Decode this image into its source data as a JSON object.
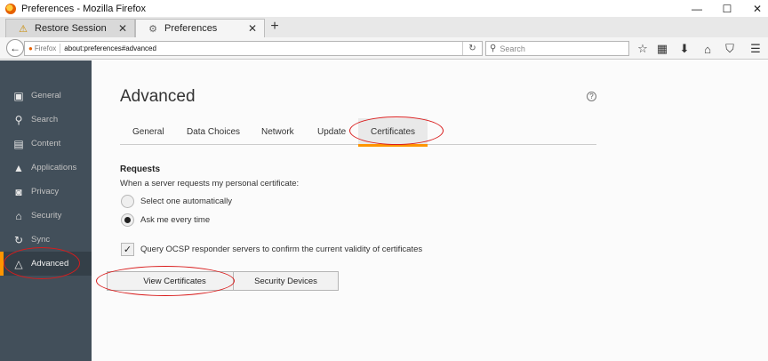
{
  "window": {
    "title": "Preferences - Mozilla Firefox",
    "min": "—",
    "max": "☐",
    "close": "✕"
  },
  "tabs": [
    {
      "label": "Restore Session",
      "icon": "warning-icon",
      "close": "✕"
    },
    {
      "label": "Preferences",
      "icon": "gear-icon",
      "close": "✕"
    }
  ],
  "new_tab": "+",
  "navbar": {
    "back": "←",
    "identity": "Firefox",
    "url": "about:preferences#advanced",
    "reload": "↻",
    "search_placeholder": "Search",
    "icons": [
      "bookmark-star-icon",
      "reading-list-icon",
      "downloads-icon",
      "home-icon",
      "pocket-icon",
      "menu-icon"
    ]
  },
  "sidebar": {
    "items": [
      {
        "label": "General",
        "icon": "general-icon",
        "glyph": "▣"
      },
      {
        "label": "Search",
        "icon": "search-icon",
        "glyph": "⚲"
      },
      {
        "label": "Content",
        "icon": "content-icon",
        "glyph": "▤"
      },
      {
        "label": "Applications",
        "icon": "applications-icon",
        "glyph": "▲"
      },
      {
        "label": "Privacy",
        "icon": "privacy-mask-icon",
        "glyph": "◙"
      },
      {
        "label": "Security",
        "icon": "security-lock-icon",
        "glyph": "⌂"
      },
      {
        "label": "Sync",
        "icon": "sync-icon",
        "glyph": "↻"
      },
      {
        "label": "Advanced",
        "icon": "advanced-wizard-icon",
        "glyph": "△"
      }
    ],
    "active": "Advanced"
  },
  "main": {
    "title": "Advanced",
    "help": "?",
    "subtabs": [
      "General",
      "Data Choices",
      "Network",
      "Update",
      "Certificates"
    ],
    "selected_subtab": "Certificates",
    "requests": {
      "heading": "Requests",
      "label": "When a server requests my personal certificate:",
      "options": [
        "Select one automatically",
        "Ask me every time"
      ],
      "selected": "Ask me every time"
    },
    "ocsp": {
      "label": "Query OCSP responder servers to confirm the current validity of certificates",
      "checked": true
    },
    "buttons": {
      "view_certificates": "View Certificates",
      "security_devices": "Security Devices"
    }
  },
  "accent_colors": {
    "orange": "#ff9500",
    "sidebar": "#424f5a",
    "annotation": "#d91c1c"
  }
}
